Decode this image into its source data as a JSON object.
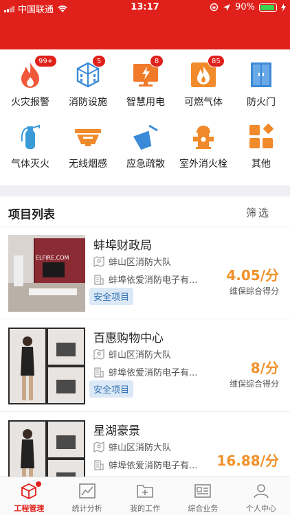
{
  "status": {
    "carrier": "中国联通",
    "time": "13:17",
    "battery": "90%",
    "battery_level": 0.9
  },
  "grid": [
    {
      "label": "火灾报警",
      "badge": "99+",
      "icon": "fire-icon",
      "color": "#f0593a"
    },
    {
      "label": "消防设施",
      "badge": "5",
      "icon": "building-icon",
      "color": "#3a8ad8"
    },
    {
      "label": "智慧用电",
      "badge": "8",
      "icon": "monitor-lightning-icon",
      "color": "#f07a2a"
    },
    {
      "label": "可燃气体",
      "badge": "85",
      "icon": "gas-flame-icon",
      "color": "#f08a2a"
    },
    {
      "label": "防火门",
      "badge": "",
      "icon": "door-icon",
      "color": "#3a8ad8"
    },
    {
      "label": "气体灭火",
      "badge": "",
      "icon": "extinguisher-icon",
      "color": "#3a9ad8"
    },
    {
      "label": "无线烟感",
      "badge": "",
      "icon": "smoke-detector-icon",
      "color": "#f08a2a"
    },
    {
      "label": "应急疏散",
      "badge": "",
      "icon": "evacuation-icon",
      "color": "#3a8ad8"
    },
    {
      "label": "室外消火栓",
      "badge": "",
      "icon": "hydrant-icon",
      "color": "#f08a2a"
    },
    {
      "label": "其他",
      "badge": "",
      "icon": "grid-icon",
      "color": "#f08a2a"
    }
  ],
  "list": {
    "title": "项目列表",
    "filter": "筛选",
    "items": [
      {
        "name": "蚌埠财政局",
        "district": "蚌山区消防大队",
        "company": "蚌埠依爱消防电子有...",
        "tag": "安全项目",
        "score": "4.05/分",
        "score_label": "维保综合得分"
      },
      {
        "name": "百惠购物中心",
        "district": "蚌山区消防大队",
        "company": "蚌埠依爱消防电子有...",
        "tag": "安全项目",
        "score": "8/分",
        "score_label": "维保综合得分"
      },
      {
        "name": "星湖豪景",
        "district": "蚌山区消防大队",
        "company": "蚌埠依爱消防电子有...",
        "tag": "",
        "score": "16.88/分",
        "score_label": ""
      }
    ]
  },
  "tabs": [
    {
      "label": "工程管理",
      "icon": "cube-icon",
      "active": true
    },
    {
      "label": "统计分析",
      "icon": "chart-icon",
      "active": false
    },
    {
      "label": "我的工作",
      "icon": "folder-plus-icon",
      "active": false
    },
    {
      "label": "综合业务",
      "icon": "id-card-icon",
      "active": false
    },
    {
      "label": "个人中心",
      "icon": "person-icon",
      "active": false
    }
  ],
  "colors": {
    "brand": "#e0201b",
    "accent": "#f0902a",
    "tag": "#2f6fb2"
  }
}
